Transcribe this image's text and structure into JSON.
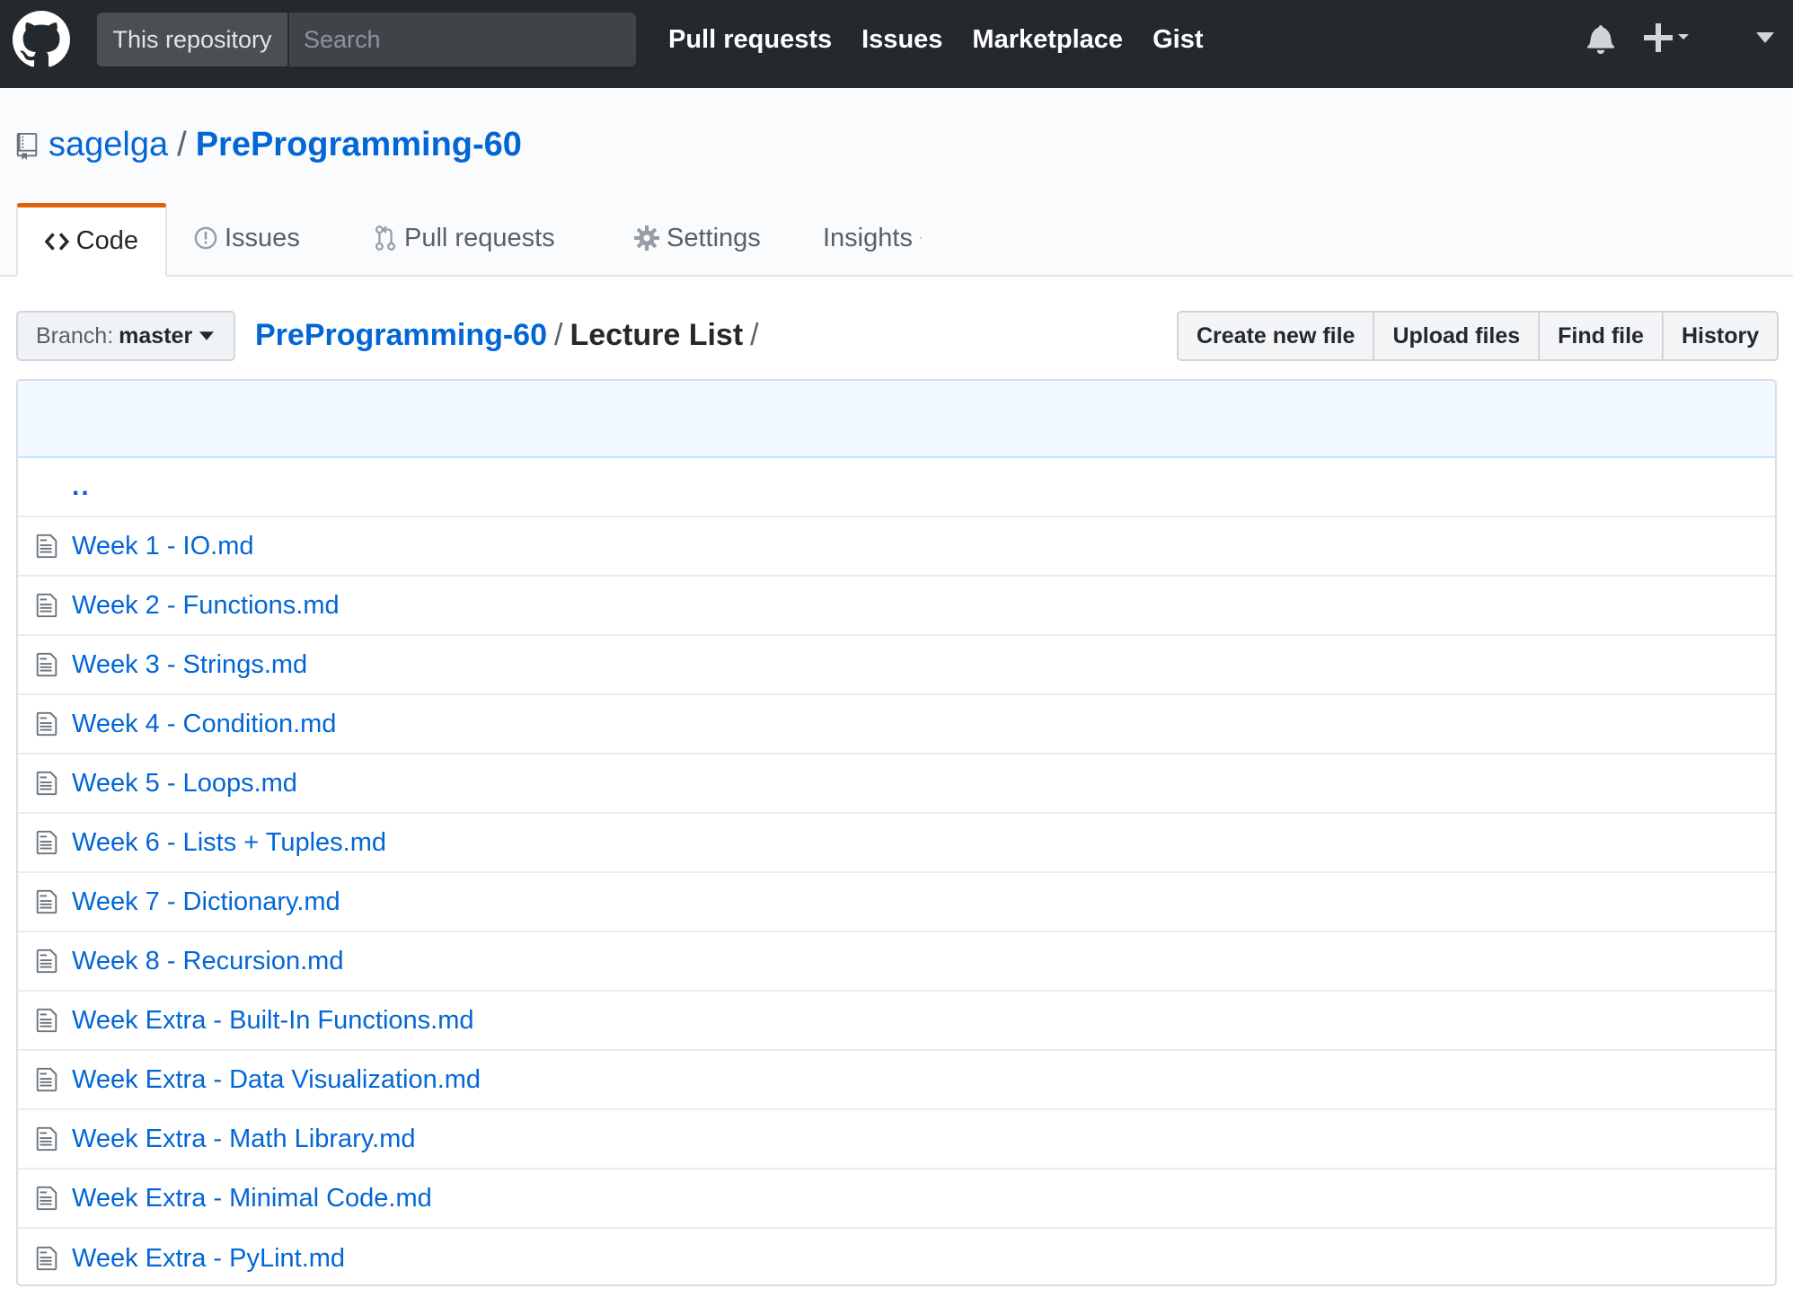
{
  "header": {
    "search_scope": "This repository",
    "search_placeholder": "Search",
    "nav": [
      "Pull requests",
      "Issues",
      "Marketplace",
      "Gist"
    ]
  },
  "repo": {
    "owner": "sagelga",
    "separator": "/",
    "name": "PreProgramming-60",
    "tabs": [
      {
        "label": "Code",
        "icon": "code-icon"
      },
      {
        "label": "Issues",
        "icon": "issue-opened-icon"
      },
      {
        "label": "Pull requests",
        "icon": "git-pull-request-icon"
      },
      {
        "label": "Settings",
        "icon": "gear-icon"
      },
      {
        "label": "Insights",
        "icon": "chevron-down-icon"
      }
    ],
    "selected_tab": "Code"
  },
  "filenav": {
    "branch_label": "Branch:",
    "branch": "master",
    "breadcrumb_root": "PreProgramming-60",
    "breadcrumb_current": "Lecture List",
    "slash": "/",
    "buttons": [
      "Create new file",
      "Upload files",
      "Find file",
      "History"
    ]
  },
  "files": {
    "parent": "..",
    "items": [
      "Week 1 - IO.md",
      "Week 2 - Functions.md",
      "Week 3 - Strings.md",
      "Week 4 - Condition.md",
      "Week 5 - Loops.md",
      "Week 6 - Lists + Tuples.md",
      "Week 7 - Dictionary.md",
      "Week 8 - Recursion.md",
      "Week Extra - Built-In Functions.md",
      "Week Extra - Data Visualization.md",
      "Week Extra - Math Library.md",
      "Week Extra - Minimal Code.md",
      "Week Extra - PyLint.md"
    ]
  },
  "colors": {
    "header_bg": "#24292e",
    "link": "#0366d6",
    "tab_accent": "#e36209",
    "commit_bar_bg": "#f1f8ff"
  }
}
